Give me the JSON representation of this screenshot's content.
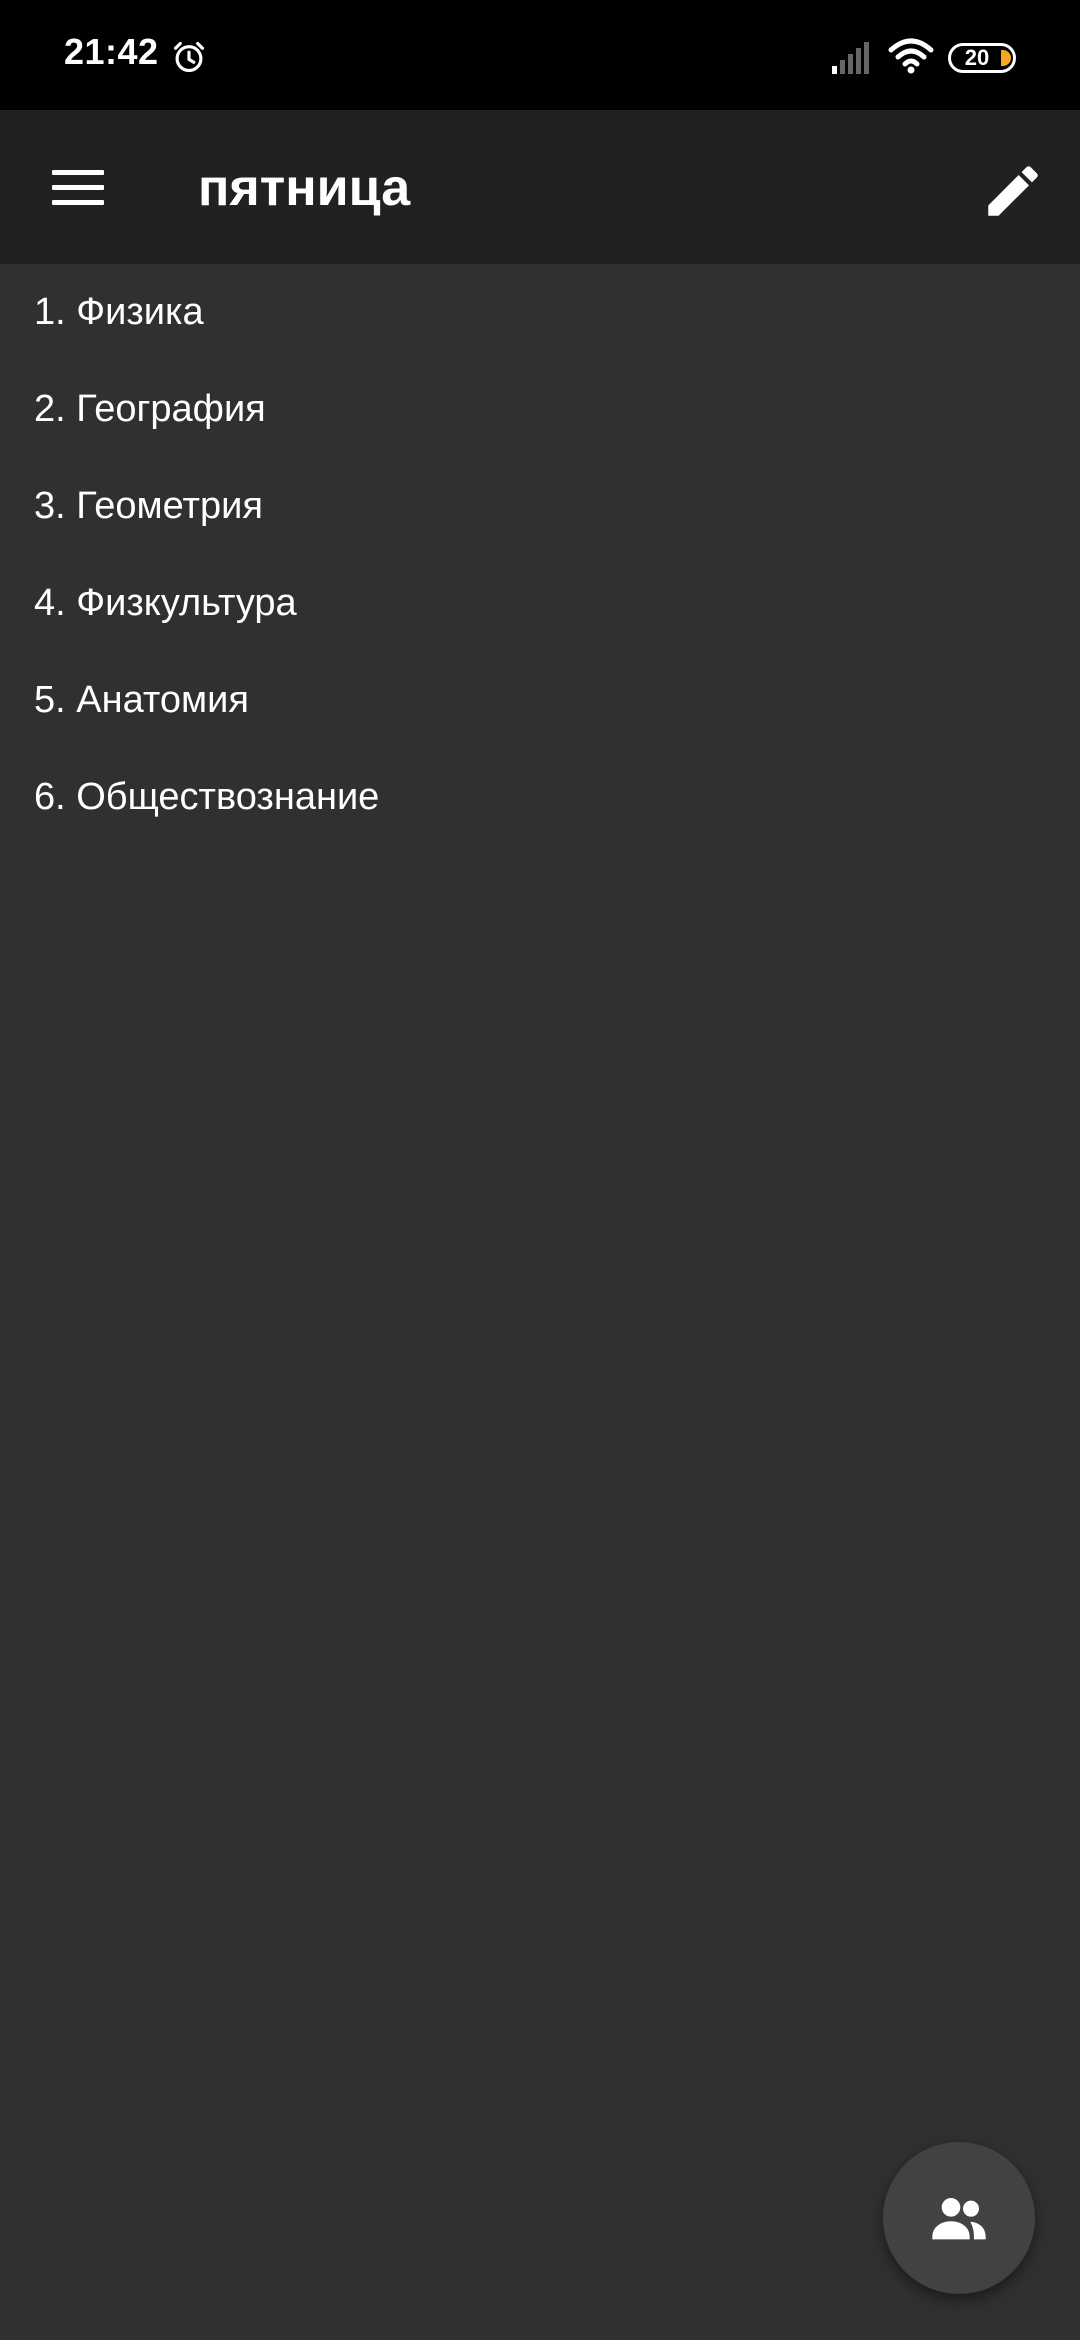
{
  "status_bar": {
    "time": "21:42",
    "alarm_icon": "alarm-clock-icon",
    "signal_icon": "cell-signal-icon",
    "wifi_icon": "wifi-icon",
    "battery_level": "20",
    "battery_charge_color": "#f5a623"
  },
  "app_bar": {
    "menu_icon": "hamburger-menu-icon",
    "title": "пятница",
    "edit_icon": "pencil-icon",
    "background": "#212121"
  },
  "lessons": [
    {
      "label": "1. Физика"
    },
    {
      "label": "2. География"
    },
    {
      "label": "3. Геометрия"
    },
    {
      "label": "4. Физкультура"
    },
    {
      "label": "5. Анатомия"
    },
    {
      "label": "6. Обществознание"
    }
  ],
  "fab": {
    "icon": "people-group-icon",
    "background": "#424242"
  },
  "theme": {
    "background": "#303030",
    "text": "#ffffff"
  }
}
